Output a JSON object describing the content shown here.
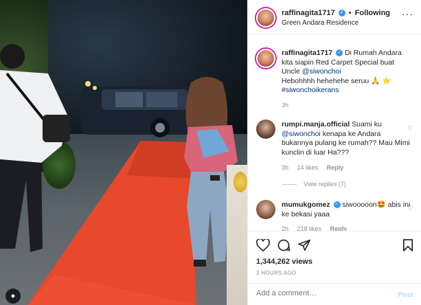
{
  "header": {
    "username": "raffinagita1717",
    "separator": "•",
    "follow_label": "Following",
    "location": "Green Andara Residence",
    "more_icon": "more-horizontal-icon"
  },
  "caption": {
    "username": "raffinagita1717",
    "text_before": "Di Rumah Andara kita siapin Red Carpet Special buat Uncle",
    "mention": "@siwonchoi",
    "text_after": "Hebohhhh hehehehe seruu 🙏 ⭐",
    "hashtag": "#siwonchoikerans",
    "time": "3h"
  },
  "comments": [
    {
      "username": "rumpi.manja.official",
      "text_before": "Suami ku",
      "mention": "@siwonchoi",
      "text_after": "kenapa ke Andara bukannya pulang ke rumah?? Mau Mimi kunclin di luar Ha???",
      "time": "3h",
      "likes": "14 likes",
      "reply": "Reply",
      "view_replies": "View replies (7)"
    },
    {
      "username": "mumukgomez",
      "text": "siwooooon🤩 abis ini ke bekasi yaaa",
      "time": "2h",
      "likes": "218 likes",
      "reply": "Reply"
    }
  ],
  "actions": {
    "views": "1,344,262 views",
    "time_ago": "3 HOURS AGO"
  },
  "add_comment": {
    "placeholder": "Add a comment…",
    "post_label": "Post"
  },
  "colors": {
    "accent": "#3897f0",
    "link": "#00376b",
    "muted": "#8e8e8e",
    "carpet": "#e8482b"
  }
}
